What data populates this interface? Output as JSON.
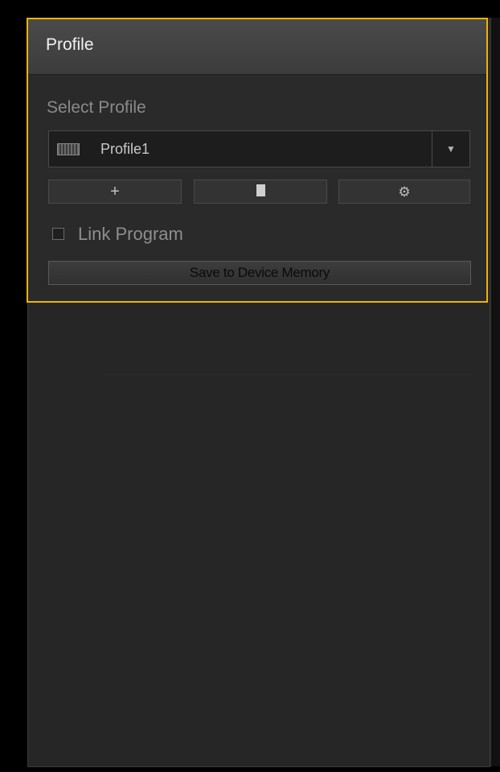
{
  "profile_panel": {
    "title": "Profile",
    "select_label": "Select Profile",
    "selected_profile": "Profile1",
    "profile_icon": "keyboard-icon",
    "dropdown_icon": "triangle-down-icon",
    "actions": [
      {
        "name": "add",
        "icon": "plus-icon",
        "glyph": "+"
      },
      {
        "name": "delete",
        "icon": "trash-icon"
      },
      {
        "name": "settings",
        "icon": "gear-icon",
        "glyph": "⚙"
      }
    ],
    "link_program": {
      "label": "Link Program",
      "checked": false
    },
    "save_label": "Save to Device Memory"
  },
  "colors": {
    "highlight_border": "#f0b400",
    "panel_bg": "#262626",
    "header_bg": "#434343"
  }
}
